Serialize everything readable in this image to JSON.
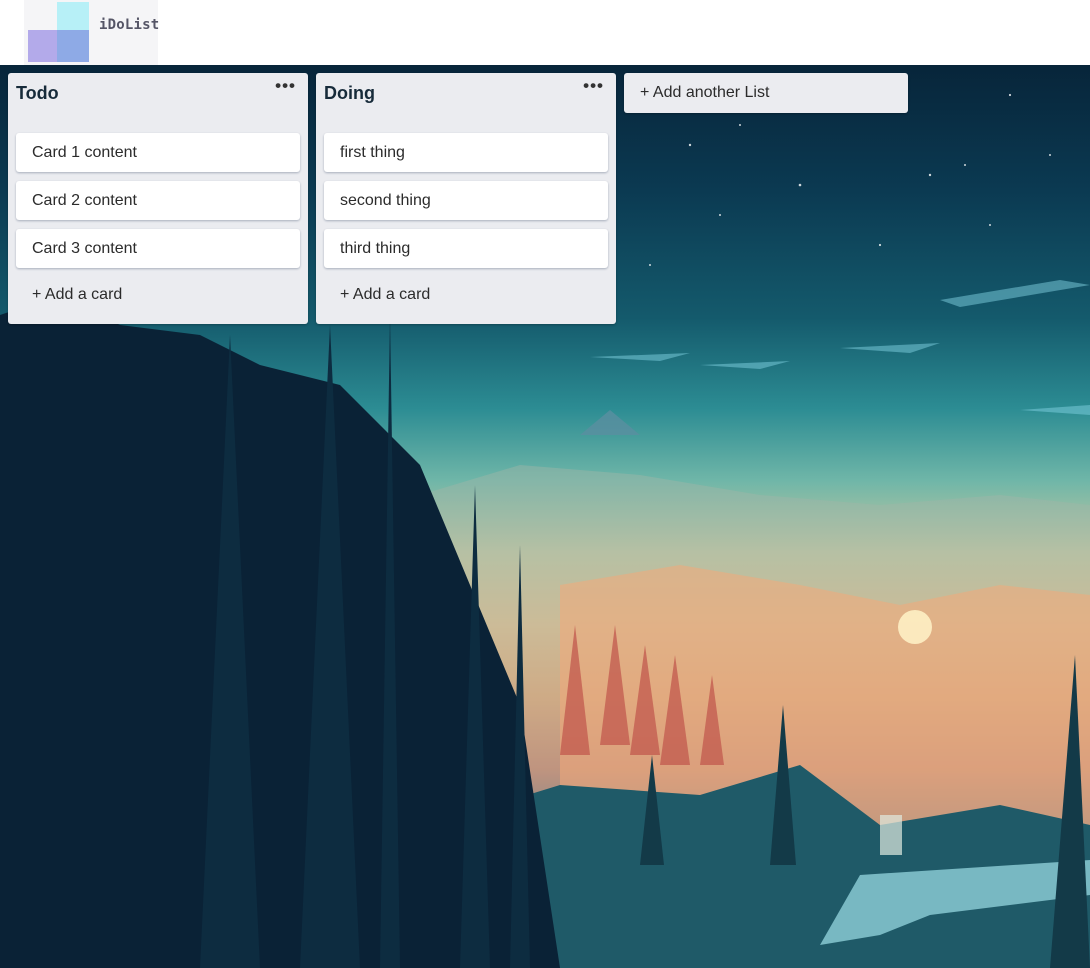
{
  "app": {
    "name": "iDoList"
  },
  "lists": [
    {
      "title": "Todo",
      "menu_glyph": "•••",
      "cards": [
        "Card 1 content",
        "Card 2 content",
        "Card 3 content"
      ],
      "add_card_label": "+ Add a card"
    },
    {
      "title": "Doing",
      "menu_glyph": "•••",
      "cards": [
        "first thing",
        "second thing",
        "third thing"
      ],
      "add_card_label": "+ Add a card"
    }
  ],
  "add_list_label": "+ Add another List",
  "colors": {
    "list_bg": "#ebecf0",
    "card_bg": "#ffffff",
    "logo_cyan": "#b7f0f7",
    "logo_lavender": "#b3aaea",
    "logo_blue": "#8eaae6"
  },
  "icons": {
    "list_menu": "more-horizontal-icon"
  }
}
